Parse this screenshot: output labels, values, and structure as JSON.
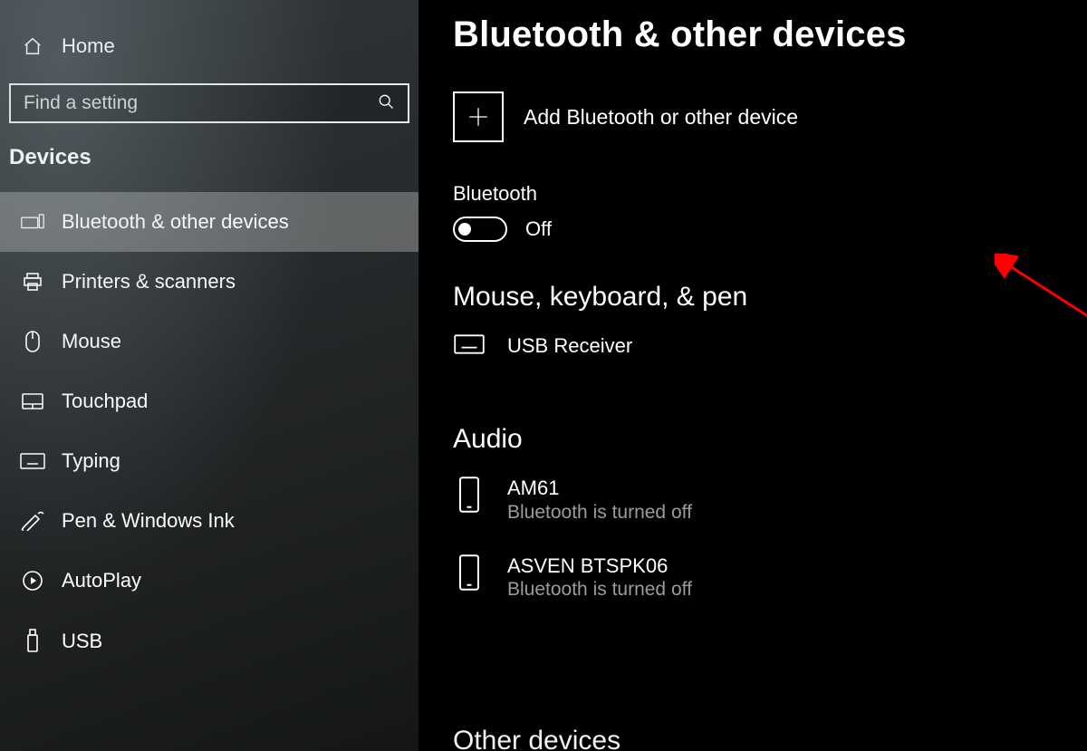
{
  "sidebar": {
    "home_label": "Home",
    "search_placeholder": "Find a setting",
    "section": "Devices",
    "items": [
      {
        "id": "bluetooth",
        "label": "Bluetooth & other devices",
        "active": true
      },
      {
        "id": "printers",
        "label": "Printers & scanners"
      },
      {
        "id": "mouse",
        "label": "Mouse"
      },
      {
        "id": "touchpad",
        "label": "Touchpad"
      },
      {
        "id": "typing",
        "label": "Typing"
      },
      {
        "id": "pen",
        "label": "Pen & Windows Ink"
      },
      {
        "id": "autoplay",
        "label": "AutoPlay"
      },
      {
        "id": "usb",
        "label": "USB"
      }
    ]
  },
  "main": {
    "title": "Bluetooth & other devices",
    "add_label": "Add Bluetooth or other device",
    "bluetooth": {
      "label": "Bluetooth",
      "state_label": "Off",
      "is_on": false
    },
    "sections": {
      "mkp": {
        "heading": "Mouse, keyboard, & pen",
        "devices": [
          {
            "name": "USB Receiver",
            "status": ""
          }
        ]
      },
      "audio": {
        "heading": "Audio",
        "devices": [
          {
            "name": "AM61",
            "status": "Bluetooth is turned off"
          },
          {
            "name": "ASVEN BTSPK06",
            "status": "Bluetooth is turned off"
          }
        ]
      },
      "other": {
        "heading": "Other devices"
      }
    }
  },
  "annotation": {
    "type": "arrow",
    "color": "#ff0000",
    "target": "bluetooth-toggle"
  }
}
